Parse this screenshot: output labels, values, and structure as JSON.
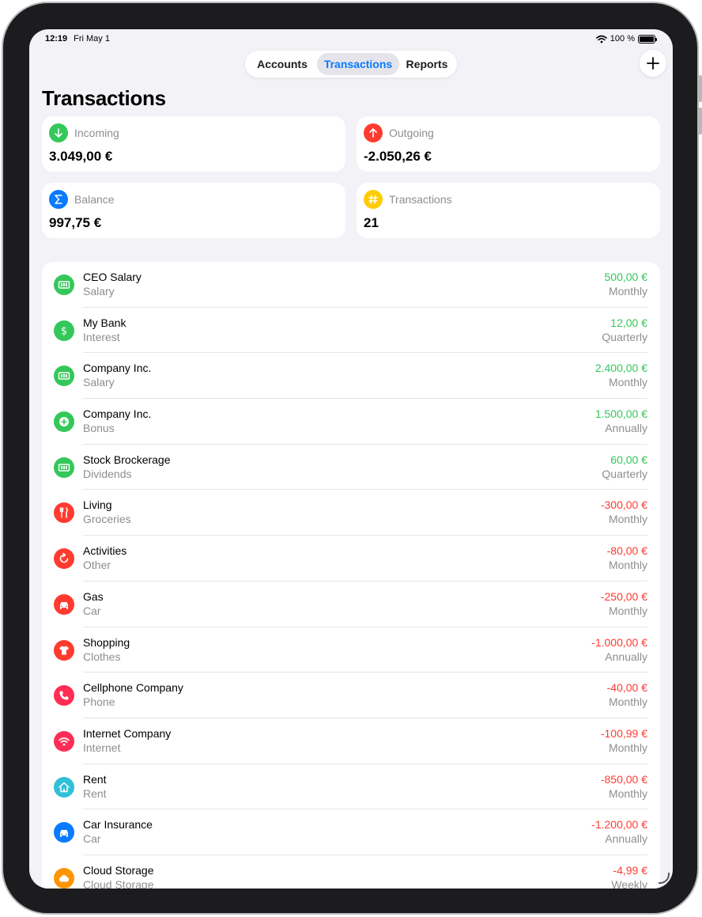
{
  "status": {
    "time": "12:19",
    "date": "Fri May 1",
    "battery": "100 %"
  },
  "tabs": [
    {
      "label": "Accounts"
    },
    {
      "label": "Transactions"
    },
    {
      "label": "Reports"
    }
  ],
  "page_title": "Transactions",
  "summary": {
    "incoming": {
      "label": "Incoming",
      "value": "3.049,00 €",
      "color": "#34c759",
      "icon": "arrow-down-icon"
    },
    "outgoing": {
      "label": "Outgoing",
      "value": "-2.050,26 €",
      "color": "#ff3b30",
      "icon": "arrow-up-icon"
    },
    "balance": {
      "label": "Balance",
      "value": "997,75 €",
      "color": "#0a7aff",
      "icon": "sigma-icon"
    },
    "count": {
      "label": "Transactions",
      "value": "21",
      "color": "#ffcc00",
      "icon": "hash-icon"
    }
  },
  "transactions": [
    {
      "title": "CEO Salary",
      "category": "Salary",
      "amount": "500,00 €",
      "frequency": "Monthly",
      "sign": "pos",
      "icon": "banknote-icon",
      "icon_color": "#34c759"
    },
    {
      "title": "My Bank",
      "category": "Interest",
      "amount": "12,00 €",
      "frequency": "Quarterly",
      "sign": "pos",
      "icon": "dollar-icon",
      "icon_color": "#34c759"
    },
    {
      "title": "Company Inc.",
      "category": "Salary",
      "amount": "2.400,00 €",
      "frequency": "Monthly",
      "sign": "pos",
      "icon": "banknote-icon",
      "icon_color": "#34c759"
    },
    {
      "title": "Company Inc.",
      "category": "Bonus",
      "amount": "1.500,00 €",
      "frequency": "Annually",
      "sign": "pos",
      "icon": "plus-circle-icon",
      "icon_color": "#34c759"
    },
    {
      "title": "Stock Brockerage",
      "category": "Dividends",
      "amount": "60,00 €",
      "frequency": "Quarterly",
      "sign": "pos",
      "icon": "banknote-icon",
      "icon_color": "#34c759"
    },
    {
      "title": "Living",
      "category": "Groceries",
      "amount": "-300,00 €",
      "frequency": "Monthly",
      "sign": "neg",
      "icon": "fork-knife-icon",
      "icon_color": "#ff3b30"
    },
    {
      "title": "Activities",
      "category": "Other",
      "amount": "-80,00 €",
      "frequency": "Monthly",
      "sign": "neg",
      "icon": "refresh-icon",
      "icon_color": "#ff3b30"
    },
    {
      "title": "Gas",
      "category": "Car",
      "amount": "-250,00 €",
      "frequency": "Monthly",
      "sign": "neg",
      "icon": "car-icon",
      "icon_color": "#ff3b30"
    },
    {
      "title": "Shopping",
      "category": "Clothes",
      "amount": "-1.000,00 €",
      "frequency": "Annually",
      "sign": "neg",
      "icon": "tshirt-icon",
      "icon_color": "#ff3b30"
    },
    {
      "title": "Cellphone Company",
      "category": "Phone",
      "amount": "-40,00 €",
      "frequency": "Monthly",
      "sign": "neg",
      "icon": "phone-icon",
      "icon_color": "#ff2d55"
    },
    {
      "title": "Internet Company",
      "category": "Internet",
      "amount": "-100,99 €",
      "frequency": "Monthly",
      "sign": "neg",
      "icon": "wifi-icon",
      "icon_color": "#ff2d55"
    },
    {
      "title": "Rent",
      "category": "Rent",
      "amount": "-850,00 €",
      "frequency": "Monthly",
      "sign": "neg",
      "icon": "house-icon",
      "icon_color": "#30c0d8"
    },
    {
      "title": "Car Insurance",
      "category": "Car",
      "amount": "-1.200,00 €",
      "frequency": "Annually",
      "sign": "neg",
      "icon": "car-icon",
      "icon_color": "#0a7aff"
    },
    {
      "title": "Cloud Storage",
      "category": "Cloud Storage",
      "amount": "-4,99 €",
      "frequency": "Weekly",
      "sign": "neg",
      "icon": "cloud-icon",
      "icon_color": "#ff9500"
    }
  ]
}
